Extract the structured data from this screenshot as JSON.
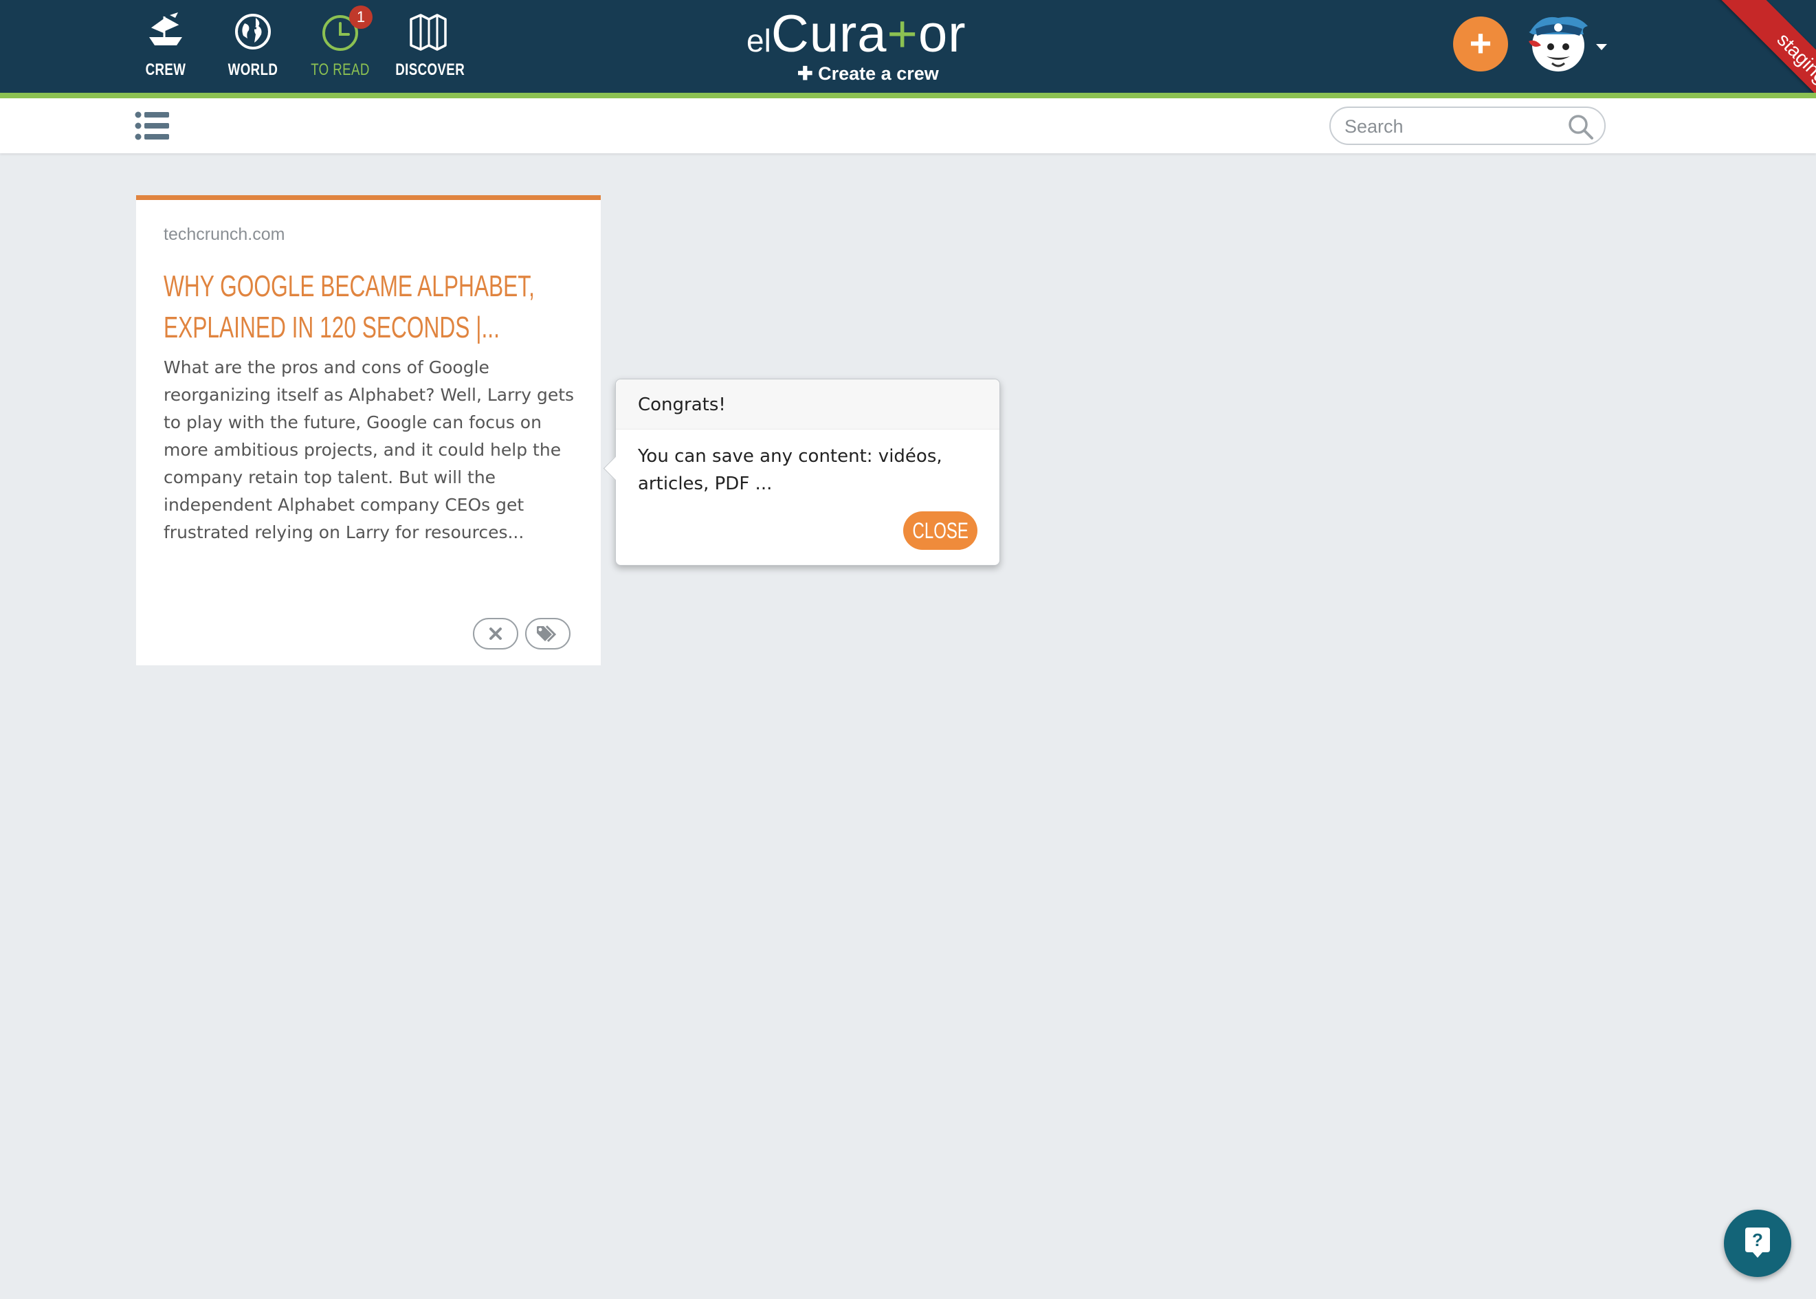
{
  "nav": {
    "items": [
      {
        "label": "CREW",
        "icon": "ship-icon"
      },
      {
        "label": "WORLD",
        "icon": "globe-icon"
      },
      {
        "label": "TO READ",
        "icon": "clock-icon",
        "badge": "1",
        "active": true
      },
      {
        "label": "DISCOVER",
        "icon": "map-icon"
      }
    ]
  },
  "logo": {
    "prefix": "el",
    "main_left": "Cura",
    "main_plus": "+",
    "main_right": "or"
  },
  "header": {
    "create_crew_label": "✚ Create a crew",
    "add_label": "+",
    "environment_label": "staging"
  },
  "search": {
    "placeholder": "Search"
  },
  "card": {
    "source": "techcrunch.com",
    "title": "Why Google Became Alphabet, Explained In 120 Seconds |...",
    "excerpt": "What are the pros and cons of Google reorganizing itself as Alphabet? Well, Larry gets to play with the future, Google can focus on more ambitious projects, and it could help the company retain top talent. But will the independent Alphabet company CEOs get frustrated relying on Larry for resources..."
  },
  "popover": {
    "title": "Congrats!",
    "message": "You can save any content: vidéos, articles, PDF ...",
    "close_label": "Close"
  },
  "colors": {
    "navbar": "#173b52",
    "accent_green": "#8cc152",
    "accent_orange": "#ef8b3b",
    "title_orange": "#e0843f",
    "staging_red": "#c62828",
    "help_teal": "#136478",
    "badge_red": "#c0392b"
  }
}
